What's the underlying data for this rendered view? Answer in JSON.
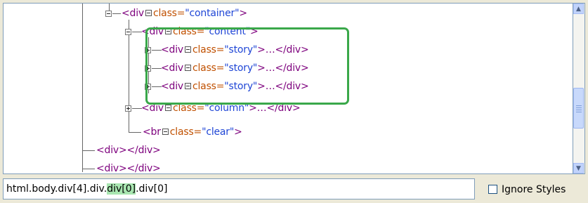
{
  "tree": {
    "rows": [
      {
        "id": "container",
        "tag": "<div",
        "attr": "class=",
        "value": "\"container\"",
        "end": ">"
      },
      {
        "id": "content",
        "tag": "<div",
        "attr": "class=",
        "value": "\"content\"",
        "end": ">"
      },
      {
        "id": "story1",
        "tag": "<div",
        "attr": "class=",
        "value": "\"story\"",
        "end": ">…</div>"
      },
      {
        "id": "story2",
        "tag": "<div",
        "attr": "class=",
        "value": "\"story\"",
        "end": ">…</div>"
      },
      {
        "id": "story3",
        "tag": "<div",
        "attr": "class=",
        "value": "\"story\"",
        "end": ">…</div>"
      },
      {
        "id": "column",
        "tag": "<div",
        "attr": "class=",
        "value": "\"column\"",
        "end": ">…</div>"
      },
      {
        "id": "br",
        "tag": "<br",
        "attr": "class=",
        "value": "\"clear\"",
        "end": ">"
      },
      {
        "id": "div-a",
        "text": "<div></div>"
      },
      {
        "id": "div-b",
        "text": "<div></div>"
      }
    ]
  },
  "path_bar": {
    "prefix": "html.body.div[4].div.",
    "highlight": "div[0]",
    "suffix": ".div[0]"
  },
  "ignore_styles": {
    "label": "Ignore Styles",
    "checked": false
  }
}
